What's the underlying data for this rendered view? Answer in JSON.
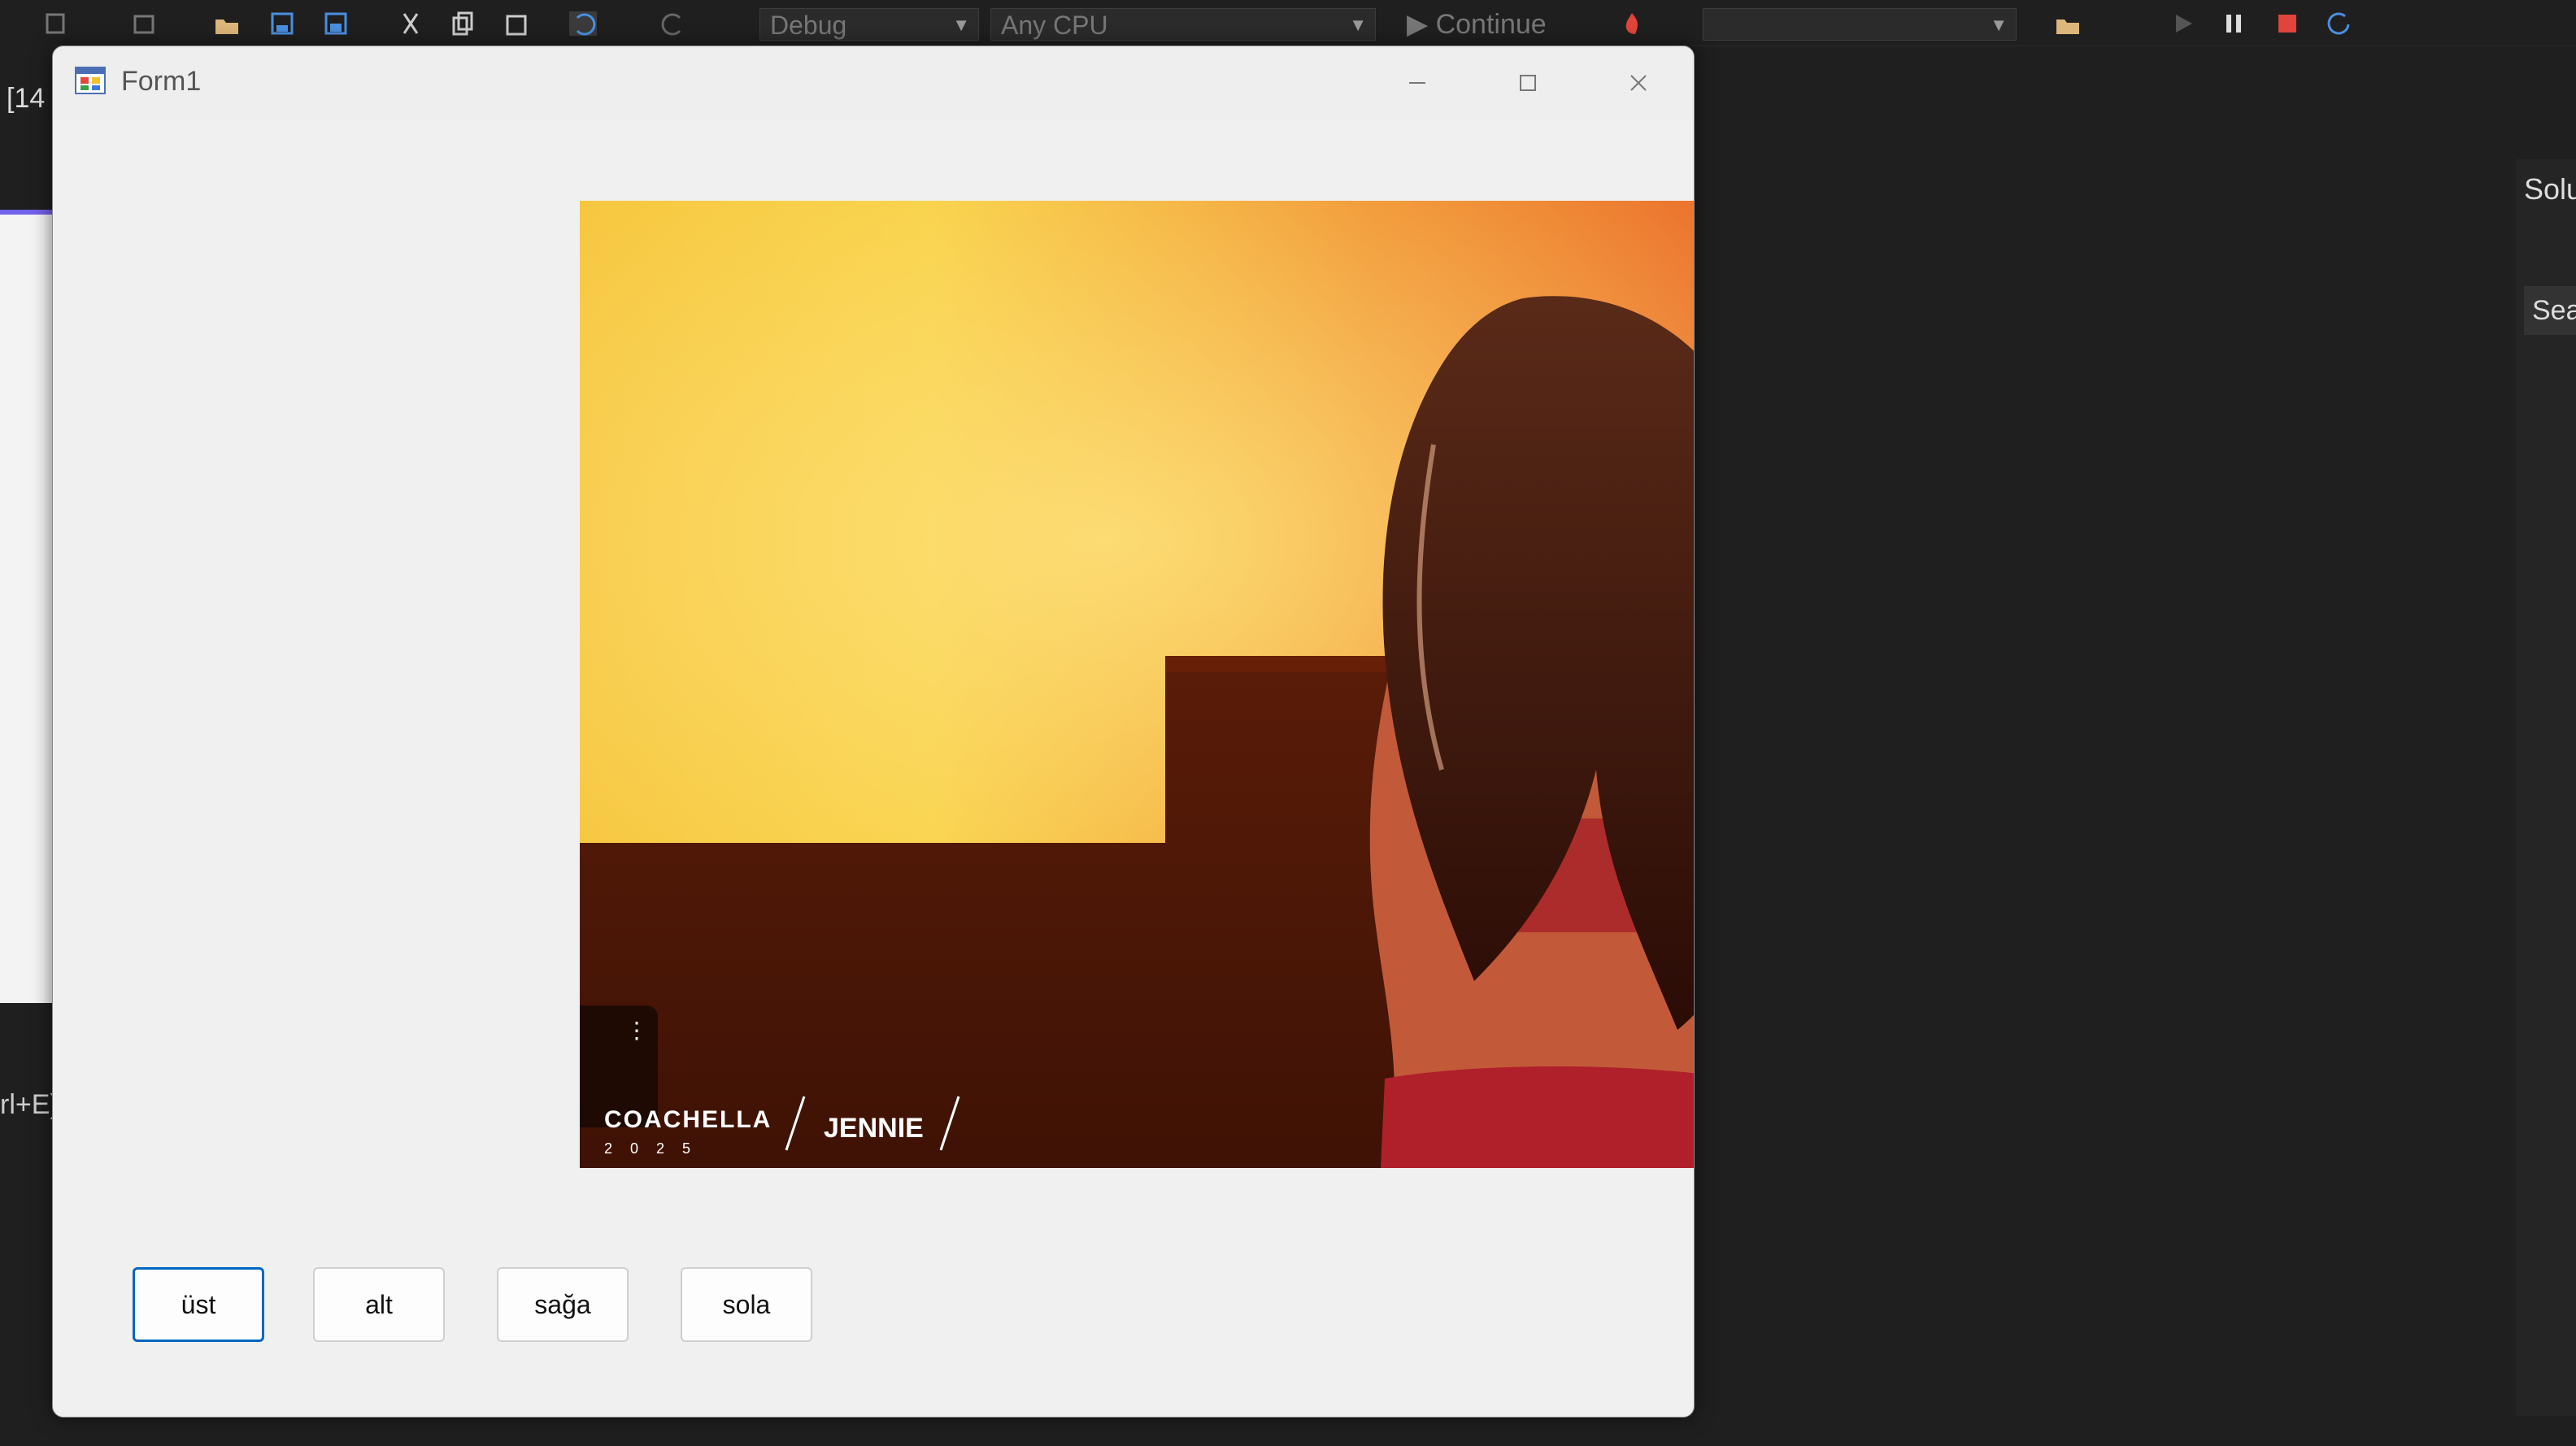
{
  "vs": {
    "config_combo": "Debug",
    "platform_combo": "Any CPU",
    "continue_label": "Continue",
    "left_tab": "[14",
    "left_shortcut": "rl+E)",
    "right_panel_title": "Solu",
    "right_search": "Sea"
  },
  "form": {
    "title": "Form1",
    "picture": {
      "overlay_coachella": "COACHELLA",
      "overlay_year": "2025",
      "overlay_name": "JENNIE"
    },
    "buttons": {
      "ust": "üst",
      "alt": "alt",
      "saga": "sağa",
      "sola": "sola"
    }
  },
  "icons": [
    "app-icon",
    "minimize-icon",
    "maximize-icon",
    "close-icon"
  ],
  "colors": {
    "focus_border": "#0067c0",
    "form_background": "#f0f0f0",
    "vs_dark": "#1f1f1f"
  }
}
